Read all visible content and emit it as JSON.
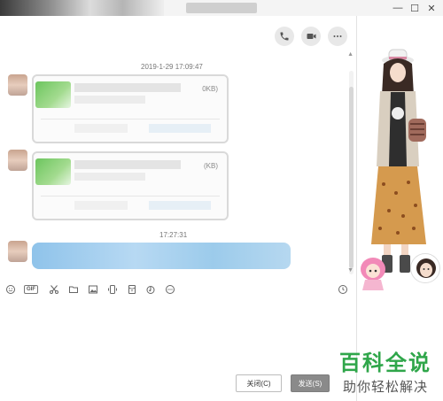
{
  "titlebar": {
    "minimize_glyph": "—",
    "maximize_glyph": "☐",
    "close_glyph": "✕"
  },
  "chat": {
    "messages": [
      {
        "type": "file",
        "timestamp": "2019-1-29 17:09:47",
        "size_text": "0KB)"
      },
      {
        "type": "file",
        "timestamp": "",
        "size_text": "(KB)"
      },
      {
        "type": "text",
        "timestamp": "17:27:31"
      }
    ]
  },
  "toolbar": {
    "gif_label": "GIF"
  },
  "input": {
    "close_button": "关闭(C)",
    "send_button": "发送(S)"
  },
  "watermark": {
    "title": "百科全说",
    "subtitle": "助你轻松解决"
  },
  "colors": {
    "accent_blue_bubble": "#9ccbeb",
    "send_button": "#8a8a8a",
    "watermark_green": "#2fa64a"
  }
}
